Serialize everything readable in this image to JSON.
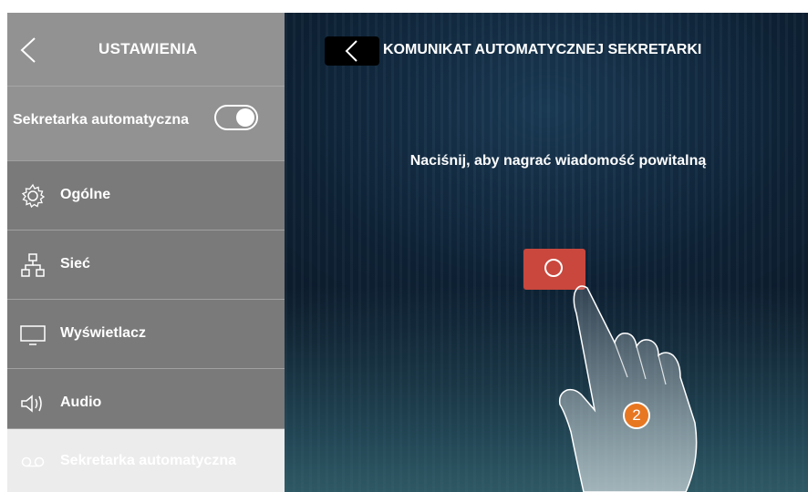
{
  "sidebar": {
    "title": "USTAWIENIA",
    "toggle": {
      "label": "Sekretarka automatyczna",
      "state": "on"
    },
    "items": [
      {
        "label": "Ogólne",
        "icon": "gear-icon"
      },
      {
        "label": "Sieć",
        "icon": "network-icon"
      },
      {
        "label": "Wyświetlacz",
        "icon": "monitor-icon"
      },
      {
        "label": "Audio",
        "icon": "speaker-icon"
      },
      {
        "label": "Sekretarka automatyczna",
        "icon": "voicemail-icon",
        "active": true
      }
    ]
  },
  "main": {
    "title": "KOMUNIKAT AUTOMATYCZNEJ SEKRETARKI",
    "prompt": "Naciśnij, aby nagrać wiadomość powitalną",
    "record_button_color": "#c9473d",
    "step_number": "2"
  }
}
